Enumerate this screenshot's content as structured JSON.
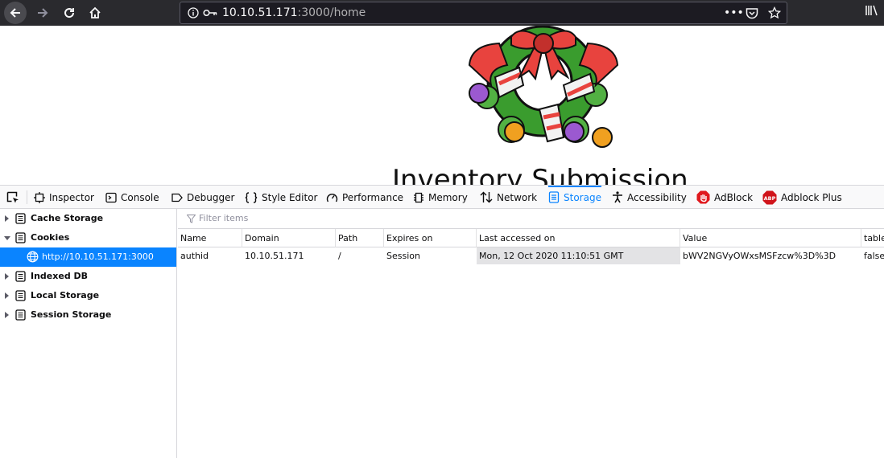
{
  "browser": {
    "url_host": "10.10.51.171",
    "url_rest": ":3000/home",
    "page_actions": "•••"
  },
  "page": {
    "heading": "Inventory Submission"
  },
  "devtools": {
    "tabs": [
      {
        "label": "Inspector"
      },
      {
        "label": "Console"
      },
      {
        "label": "Debugger"
      },
      {
        "label": "Style Editor"
      },
      {
        "label": "Performance"
      },
      {
        "label": "Memory"
      },
      {
        "label": "Network"
      },
      {
        "label": "Storage"
      },
      {
        "label": "Accessibility"
      },
      {
        "label": "AdBlock"
      },
      {
        "label": "Adblock Plus"
      }
    ],
    "active_tab": "Storage",
    "sidebar": {
      "items": [
        {
          "label": "Cache Storage"
        },
        {
          "label": "Cookies"
        },
        {
          "label": "http://10.10.51.171:3000"
        },
        {
          "label": "Indexed DB"
        },
        {
          "label": "Local Storage"
        },
        {
          "label": "Session Storage"
        }
      ]
    },
    "filter_placeholder": "Filter items",
    "table": {
      "columns": [
        "Name",
        "Domain",
        "Path",
        "Expires on",
        "Last accessed on",
        "Value",
        "table"
      ],
      "rows": [
        [
          "authid",
          "10.10.51.171",
          "/",
          "Session",
          "Mon, 12 Oct 2020 11:10:51 GMT",
          "bWV2NGVyOWxsMSFzcw%3D%3D",
          "false"
        ]
      ]
    },
    "accent_color": "#0a84ff"
  }
}
